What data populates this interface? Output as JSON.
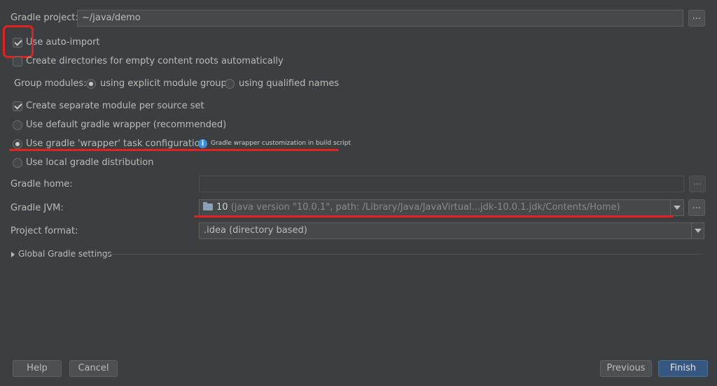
{
  "gradle_project": {
    "label": "Gradle project:",
    "value": "~/java/demo",
    "browse": "..."
  },
  "auto_import": {
    "label": "Use auto-import",
    "checked": true
  },
  "create_dirs": {
    "label": "Create directories for empty content roots automatically",
    "checked": false
  },
  "group_modules": {
    "label": "Group modules:",
    "options": [
      "using explicit module groups",
      "using qualified names"
    ],
    "selected": "using explicit module groups"
  },
  "separate_module": {
    "label": "Create separate module per source set",
    "checked": true
  },
  "wrapper": {
    "options": [
      "Use default gradle wrapper (recommended)",
      "Use gradle 'wrapper' task configuration",
      "Use local gradle distribution"
    ],
    "selected": "Use gradle 'wrapper' task configuration",
    "info_text": "Gradle wrapper customization in build script",
    "info_icon": "info-icon"
  },
  "gradle_home": {
    "label": "Gradle home:",
    "value": "",
    "browse": "..."
  },
  "gradle_jvm": {
    "label": "Gradle JVM:",
    "version": "10",
    "detail": "(java version \"10.0.1\", path: /Library/Java/JavaVirtual...jdk-10.0.1.jdk/Contents/Home)",
    "browse": "..."
  },
  "project_format": {
    "label": "Project format:",
    "value": ".idea (directory based)"
  },
  "global_settings": {
    "label": "Global Gradle settings"
  },
  "buttons": {
    "help": "Help",
    "cancel": "Cancel",
    "previous": "Previous",
    "finish": "Finish"
  },
  "colors": {
    "background": "#3c3f41",
    "primary_button": "#365880",
    "annotation": "#e5211d"
  }
}
